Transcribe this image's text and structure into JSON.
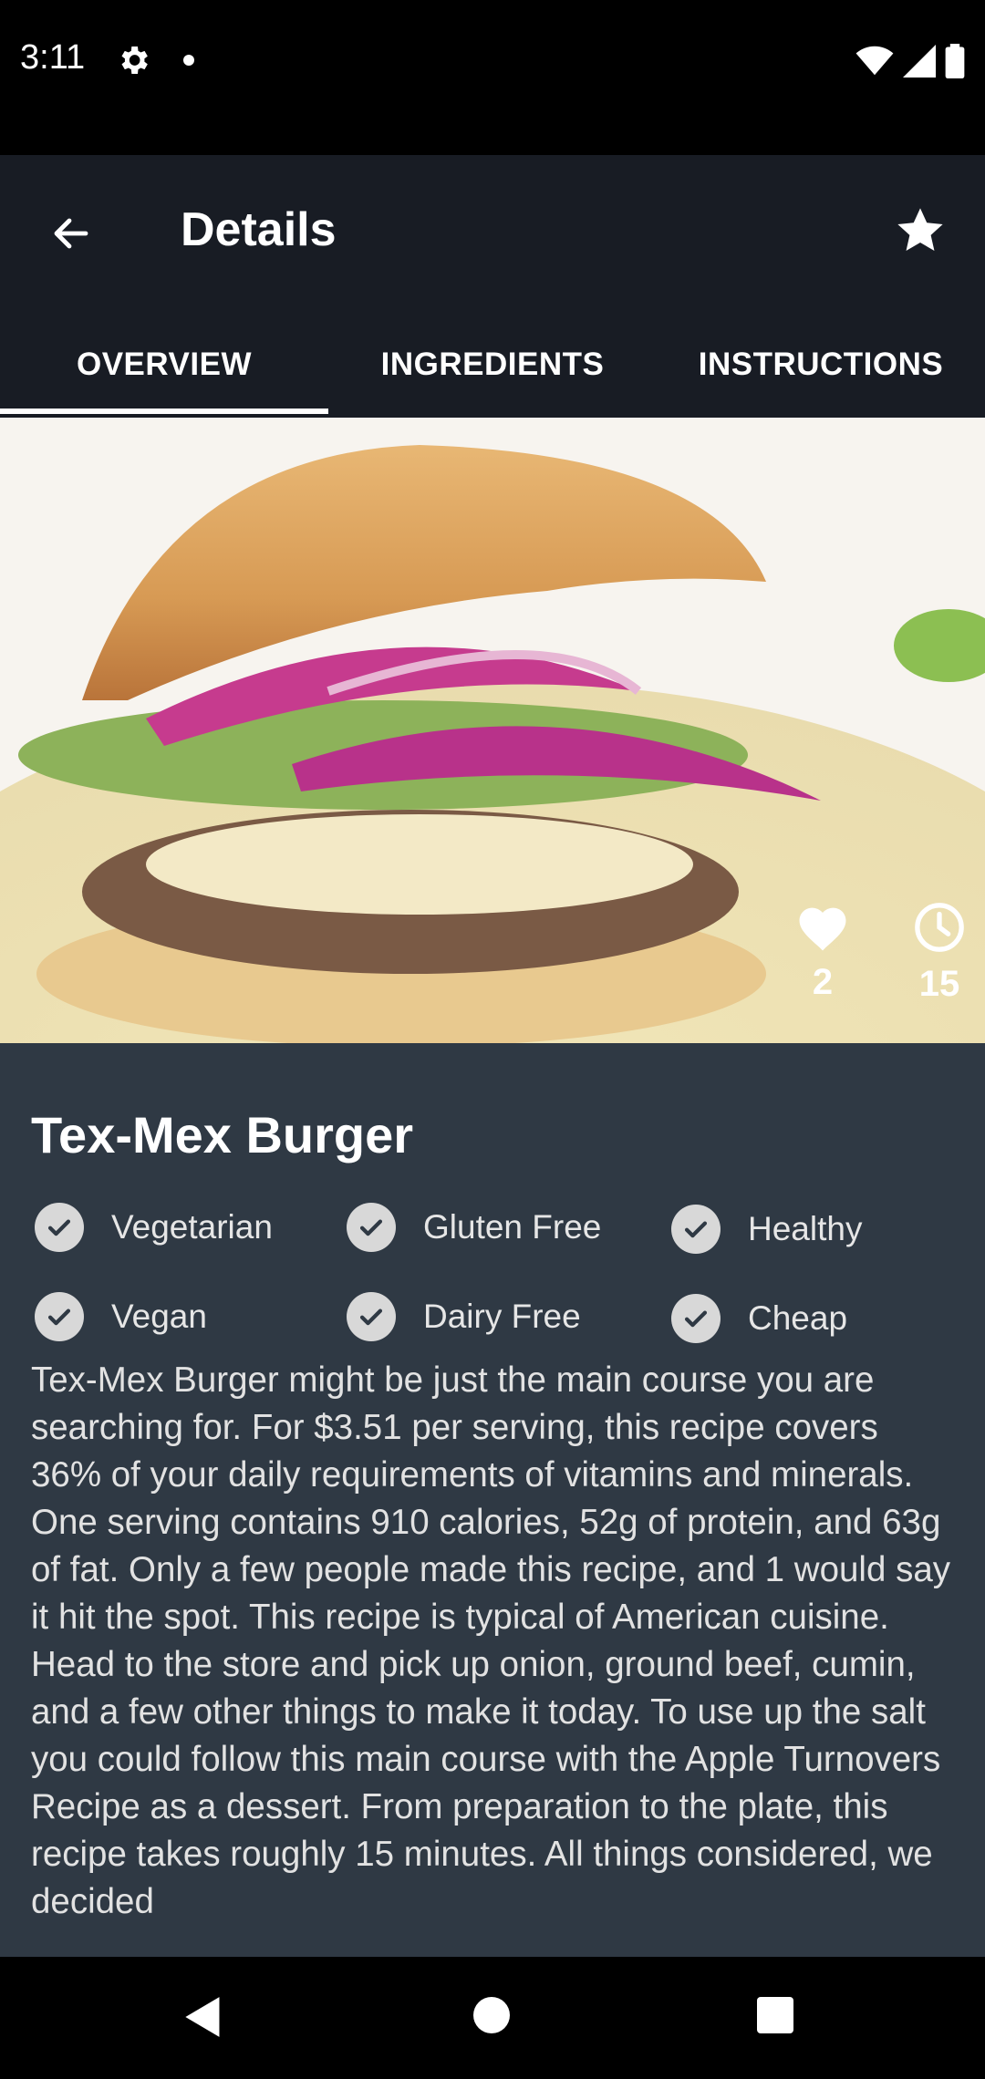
{
  "status_bar": {
    "time": "3:11",
    "icons": [
      "gear-icon",
      "notification-dot-icon",
      "wifi-icon",
      "signal-icon",
      "battery-icon"
    ]
  },
  "app_bar": {
    "title": "Details",
    "back_icon": "arrow-left-icon",
    "favorite_icon": "star-icon"
  },
  "tabs": [
    {
      "label": "OVERVIEW",
      "selected": true
    },
    {
      "label": "INGREDIENTS",
      "selected": false
    },
    {
      "label": "INSTRUCTIONS",
      "selected": false
    }
  ],
  "hero": {
    "image": "burger-photo",
    "likes": "2",
    "minutes": "15"
  },
  "recipe": {
    "title": "Tex-Mex Burger",
    "tags": [
      {
        "label": "Vegetarian"
      },
      {
        "label": "Gluten Free"
      },
      {
        "label": "Healthy"
      },
      {
        "label": "Vegan"
      },
      {
        "label": "Dairy Free"
      },
      {
        "label": "Cheap"
      }
    ],
    "description": "Tex-Mex Burger might be just the main course you are searching for. For $3.51 per serving, this recipe covers 36% of your daily requirements of vitamins and minerals. One serving contains 910 calories, 52g of protein, and 63g of fat. Only a few people made this recipe, and 1 would say it hit the spot. This recipe is typical of American cuisine. Head to the store and pick up onion, ground beef, cumin, and a few other things to make it today. To use up the salt you could follow this main course with the Apple Turnovers Recipe as a dessert. From preparation to the plate, this recipe takes roughly 15 minutes. All things considered, we decided"
  },
  "colors": {
    "status_bar": "#000000",
    "app_bar": "#181c24",
    "content_bg": "#2f3944",
    "tag_check": "#d8d8d8"
  }
}
